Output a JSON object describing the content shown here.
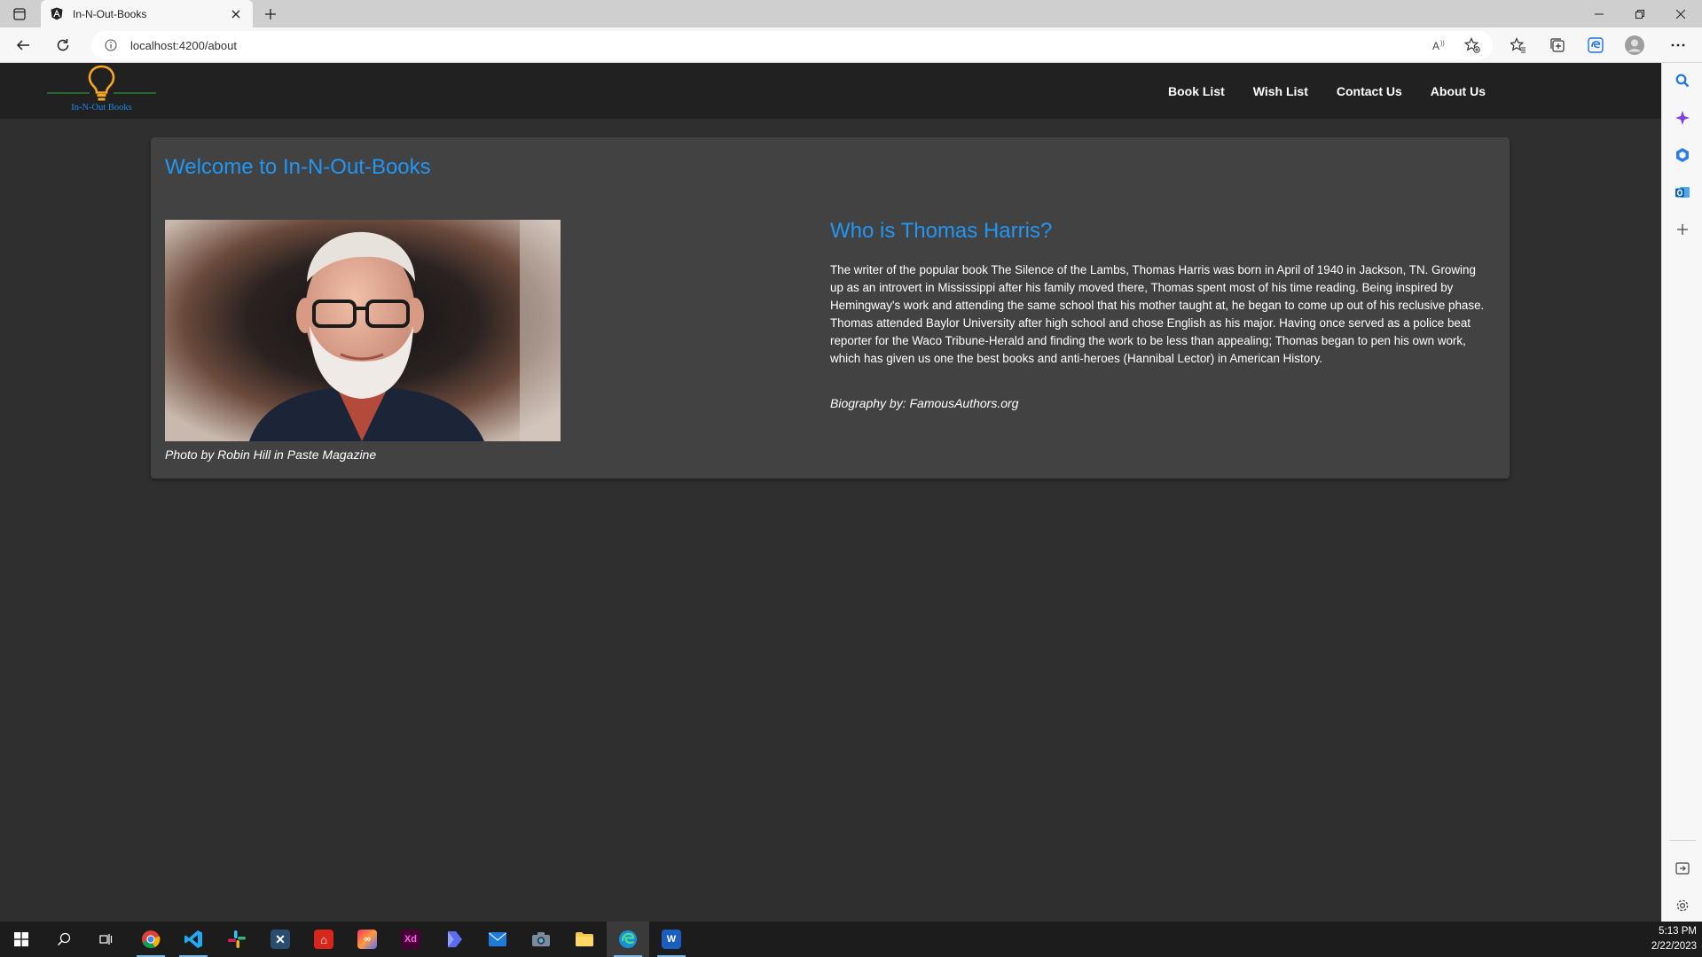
{
  "browser": {
    "tab_title": "In-N-Out-Books",
    "url": "localhost:4200/about",
    "icons": [
      "sidebar-toggle-icon",
      "angular-favicon",
      "close-icon",
      "plus-icon",
      "minimize-icon",
      "restore-icon",
      "window-close-icon",
      "back-icon",
      "refresh-icon",
      "info-icon",
      "read-aloud-icon",
      "add-favorite-icon",
      "favorites-icon",
      "collections-icon",
      "edge-icon",
      "profile-icon",
      "more-icon"
    ]
  },
  "edge_sidebar": {
    "icons": [
      "search-icon",
      "sparkle-icon",
      "office-icon",
      "outlook-icon",
      "plus-icon",
      "split-screen-icon",
      "settings-icon"
    ]
  },
  "site": {
    "logo_text": "In-N-Out Books",
    "nav": [
      "Book List",
      "Wish List",
      "Contact Us",
      "About Us"
    ]
  },
  "about": {
    "welcome": "Welcome to In-N-Out-Books",
    "photo_caption": "Photo by Robin Hill in Paste Magazine",
    "heading": "Who is Thomas Harris?",
    "bio": "The writer of the popular book The Silence of the Lambs, Thomas Harris was born in April of 1940 in Jackson, TN. Growing up as an introvert in Mississippi after his family moved there, Thomas spent most of his time reading. Being inspired by Hemingway's work and attending the same school that his mother taught at, he began to come up out of his reclusive phase. Thomas attended Baylor University after high school and chose English as his major. Having once served as a police beat reporter for the Waco Tribune-Herald and finding the work to be less than appealing; Thomas began to pen his own work, which has given us one the best books and anti-heroes (Hannibal Lector) in American History.",
    "credit": "Biography by: FamousAuthors.org"
  },
  "taskbar": {
    "apps": [
      "start-icon",
      "search-icon",
      "task-view-icon",
      "chrome-icon",
      "vscode-icon",
      "slack-icon",
      "xcode-like-icon",
      "acrobat-icon",
      "creative-cloud-icon",
      "xd-icon",
      "power-automate-icon",
      "mail-icon",
      "camera-icon",
      "file-explorer-icon",
      "edge-icon",
      "word-icon"
    ],
    "xd_label": "Xd",
    "word_label": "W",
    "time": "5:13 PM",
    "date": "2/22/2023"
  },
  "colors": {
    "page_bg": "#2f2f2f",
    "nav_bg": "#212121",
    "card_bg": "#424242",
    "accent_blue": "#2196f3",
    "logo_bulb": "#f5a623",
    "logo_line": "#2e7d32"
  }
}
